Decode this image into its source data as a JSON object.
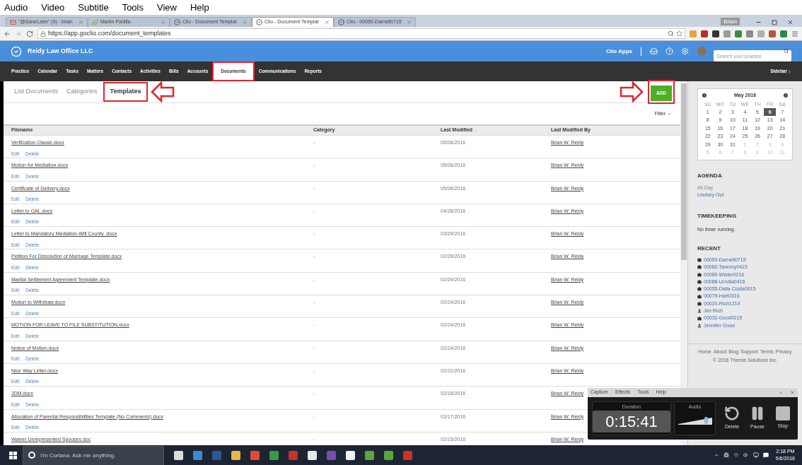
{
  "app_menu": [
    "Audio",
    "Video",
    "Subtitle",
    "Tools",
    "View",
    "Help"
  ],
  "browser": {
    "tabs": [
      {
        "kind": "mail",
        "title": "\"@SaneLater\" (9) - brian",
        "selected": false
      },
      {
        "kind": "leaf",
        "title": "Martin Padilla",
        "selected": false
      },
      {
        "kind": "check",
        "title": "Clio - Document Templat",
        "selected": false
      },
      {
        "kind": "check",
        "title": "Clio - Document Templat",
        "selected": true
      },
      {
        "kind": "check",
        "title": "Clio - 00050-Darnell0715",
        "selected": false
      }
    ],
    "profile": "Brian",
    "url": "https://app.goclio.com/document_templates",
    "extensions": [
      {
        "color": "#e8a33a"
      },
      {
        "color": "#b52d2d"
      },
      {
        "color": "#333333"
      },
      {
        "color": "#9a9a9a"
      },
      {
        "color": "#3c8c3c"
      },
      {
        "color": "#8a8a8a"
      },
      {
        "color": "#b0b0b0"
      },
      {
        "color": "#c0503a"
      },
      {
        "color": "#2c8a4a"
      }
    ]
  },
  "header": {
    "firm": "Reidy Law Office LLC",
    "apps": "Clio Apps",
    "search_placeholder": "Search your practice"
  },
  "nav": {
    "items": [
      {
        "label": "Practice",
        "selected": false
      },
      {
        "label": "Calendar",
        "selected": false
      },
      {
        "label": "Tasks",
        "selected": false
      },
      {
        "label": "Matters",
        "selected": false
      },
      {
        "label": "Contacts",
        "selected": false
      },
      {
        "label": "Activities",
        "selected": false
      },
      {
        "label": "Bills",
        "selected": false
      },
      {
        "label": "Accounts",
        "selected": false
      },
      {
        "label": "Documents",
        "selected": true
      },
      {
        "label": "Communications",
        "selected": false
      },
      {
        "label": "Reports",
        "selected": false
      }
    ],
    "sidebar": "Sidebar"
  },
  "subtabs": [
    {
      "label": "List Documents",
      "selected": false
    },
    {
      "label": "Categories",
      "selected": false
    },
    {
      "label": "Templates",
      "selected": true
    }
  ],
  "add_button": "ADD",
  "filter": "Filter",
  "table": {
    "columns": [
      {
        "label": "Filename",
        "sorted": false
      },
      {
        "label": "Category",
        "sorted": false
      },
      {
        "label": "Last Modified",
        "sorted": true
      },
      {
        "label": "Last Modified By",
        "sorted": false
      }
    ],
    "rows": [
      {
        "filename": "Verification Clause.docx",
        "category": "-",
        "modified": "05/06/2016",
        "by": "Brian W. Reidy",
        "actions": [
          "Edit",
          "Delete"
        ]
      },
      {
        "filename": "Motion for Mediation.docx",
        "category": "-",
        "modified": "05/06/2016",
        "by": "Brian W. Reidy",
        "actions": [
          "Edit",
          "Delete"
        ]
      },
      {
        "filename": "Certificate of Delivery.docx",
        "category": "-",
        "modified": "05/06/2016",
        "by": "Brian W. Reidy",
        "actions": [
          "Edit",
          "Delete"
        ]
      },
      {
        "filename": "Letter to GAL.docx",
        "category": "-",
        "modified": "04/26/2016",
        "by": "Brian W. Reidy",
        "actions": [
          "Edit",
          "Delete"
        ]
      },
      {
        "filename": "Letter to Mandatory Mediation-Will County .docx",
        "category": "-",
        "modified": "03/29/2016",
        "by": "Brian W. Reidy",
        "actions": [
          "Edit",
          "Delete"
        ]
      },
      {
        "filename": "Petition For Dissolution of Marriage Template.docx",
        "category": "-",
        "modified": "02/28/2016",
        "by": "Brian W. Reidy",
        "actions": [
          "Edit",
          "Delete"
        ]
      },
      {
        "filename": "Marital Settlement Agreement Template.docx",
        "category": "-",
        "modified": "02/24/2016",
        "by": "Brian W. Reidy",
        "actions": [
          "Edit",
          "Delete"
        ]
      },
      {
        "filename": "Motion to Withdraw.docx",
        "category": "-",
        "modified": "02/24/2016",
        "by": "Brian W. Reidy",
        "actions": [
          "Edit",
          "Delete"
        ]
      },
      {
        "filename": "MOTION FOR LEAVE TO FILE SUBSTITUTION.docx",
        "category": "-",
        "modified": "02/24/2016",
        "by": "Brian W. Reidy",
        "actions": [
          "Edit",
          "Delete"
        ]
      },
      {
        "filename": "Notice of Motion.docx",
        "category": "-",
        "modified": "02/24/2016",
        "by": "Brian W. Reidy",
        "actions": [
          "Edit",
          "Delete"
        ]
      },
      {
        "filename": "Nice Way Letter.docx",
        "category": "-",
        "modified": "02/22/2016",
        "by": "Brian W. Reidy",
        "actions": [
          "Edit",
          "Delete"
        ]
      },
      {
        "filename": "JDM.docx",
        "category": "-",
        "modified": "02/18/2016",
        "by": "Brian W. Reidy",
        "actions": [
          "Edit",
          "Delete"
        ]
      },
      {
        "filename": "Allocation of Parental Responsibilities Template (No Comments).docx",
        "category": "-",
        "modified": "02/17/2016",
        "by": "Brian W. Reidy",
        "actions": [
          "Edit",
          "Delete"
        ]
      },
      {
        "filename": "Waiver Unrepresented Spouses.doc",
        "category": "-",
        "modified": "02/15/2016",
        "by": "Brian W. Reidy"
      }
    ]
  },
  "calendar": {
    "title": "May 2016",
    "weekdays": [
      "SU",
      "MO",
      "TU",
      "WE",
      "TH",
      "FR",
      "SA"
    ],
    "days": [
      {
        "day": "1",
        "muted": false,
        "selected": false
      },
      {
        "day": "2",
        "muted": false,
        "selected": false
      },
      {
        "day": "3",
        "muted": false,
        "selected": false
      },
      {
        "day": "4",
        "muted": false,
        "selected": false
      },
      {
        "day": "5",
        "muted": false,
        "selected": false
      },
      {
        "day": "6",
        "muted": false,
        "selected": true
      },
      {
        "day": "7",
        "muted": false,
        "selected": false
      },
      {
        "day": "8",
        "muted": false,
        "selected": false
      },
      {
        "day": "9",
        "muted": false,
        "selected": false
      },
      {
        "day": "10",
        "muted": false,
        "selected": false
      },
      {
        "day": "11",
        "muted": false,
        "selected": false
      },
      {
        "day": "12",
        "muted": false,
        "selected": false
      },
      {
        "day": "13",
        "muted": false,
        "selected": false
      },
      {
        "day": "14",
        "muted": false,
        "selected": false
      },
      {
        "day": "15",
        "muted": false,
        "selected": false
      },
      {
        "day": "16",
        "muted": false,
        "selected": false
      },
      {
        "day": "17",
        "muted": false,
        "selected": false
      },
      {
        "day": "18",
        "muted": false,
        "selected": false
      },
      {
        "day": "19",
        "muted": false,
        "selected": false
      },
      {
        "day": "20",
        "muted": false,
        "selected": false
      },
      {
        "day": "21",
        "muted": false,
        "selected": false
      },
      {
        "day": "22",
        "muted": false,
        "selected": false
      },
      {
        "day": "23",
        "muted": false,
        "selected": false
      },
      {
        "day": "24",
        "muted": false,
        "selected": false
      },
      {
        "day": "25",
        "muted": false,
        "selected": false
      },
      {
        "day": "26",
        "muted": false,
        "selected": false
      },
      {
        "day": "27",
        "muted": false,
        "selected": false
      },
      {
        "day": "28",
        "muted": false,
        "selected": false
      },
      {
        "day": "29",
        "muted": false,
        "selected": false
      },
      {
        "day": "30",
        "muted": false,
        "selected": false
      },
      {
        "day": "31",
        "muted": false,
        "selected": false
      },
      {
        "day": "1",
        "muted": true,
        "selected": false
      },
      {
        "day": "2",
        "muted": true,
        "selected": false
      },
      {
        "day": "3",
        "muted": true,
        "selected": false
      },
      {
        "day": "4",
        "muted": true,
        "selected": false
      },
      {
        "day": "5",
        "muted": true,
        "selected": false
      },
      {
        "day": "6",
        "muted": true,
        "selected": false
      },
      {
        "day": "7",
        "muted": true,
        "selected": false
      },
      {
        "day": "8",
        "muted": true,
        "selected": false
      },
      {
        "day": "9",
        "muted": true,
        "selected": false
      },
      {
        "day": "10",
        "muted": true,
        "selected": false
      },
      {
        "day": "11",
        "muted": true,
        "selected": false
      }
    ]
  },
  "agenda": {
    "heading": "AGENDA",
    "label": "All Day",
    "event": "Lindsey Out"
  },
  "timekeeping": {
    "heading": "TIMEKEEPING",
    "text": "No timer running."
  },
  "recent": {
    "heading": "RECENT",
    "items": [
      {
        "kind": "matter",
        "label": "00050-Darnell0715"
      },
      {
        "kind": "matter",
        "label": "00082-Tancrey0415"
      },
      {
        "kind": "matter",
        "label": "00089-Wister0216"
      },
      {
        "kind": "matter",
        "label": "00088-Urrutia0416"
      },
      {
        "kind": "matter",
        "label": "00055-Dalla Costa0915"
      },
      {
        "kind": "matter",
        "label": "00079-Hart0316"
      },
      {
        "kind": "matter",
        "label": "00020-Rich1214"
      },
      {
        "kind": "contact",
        "label": "Jim Rich"
      },
      {
        "kind": "matter",
        "label": "00032-Good0215"
      },
      {
        "kind": "contact",
        "label": "Jennifer Good"
      }
    ]
  },
  "footer": {
    "links": [
      "Home",
      "About",
      "Blog",
      "Support",
      "Terms",
      "Privacy"
    ],
    "copyright": "© 2016 Themis Solutions Inc."
  },
  "recorder": {
    "menu": [
      "Capture",
      "Effects",
      "Tools",
      "Help"
    ],
    "duration_label": "Duration",
    "duration": "0:15:41",
    "audio": {
      "label": "Audio",
      "level": 0.85
    },
    "buttons": [
      {
        "kind": "delete",
        "label": "Delete"
      },
      {
        "kind": "pause",
        "label": "Pause"
      },
      {
        "kind": "stop",
        "label": "Stop"
      }
    ]
  },
  "taskbar": {
    "search_placeholder": "I'm Cortana. Ask me anything.",
    "apps": [
      {
        "color": "#dddddd"
      },
      {
        "color": "#3b8ad8"
      },
      {
        "color": "#2b5797"
      },
      {
        "color": "#e8b84a"
      },
      {
        "color": "#e04a3a"
      },
      {
        "color": "#3a9a4a"
      },
      {
        "color": "#c8302a"
      },
      {
        "color": "#e8e8e8"
      },
      {
        "color": "#7a4ab0"
      },
      {
        "color": "#f0f0f0"
      },
      {
        "color": "#5aa83a"
      },
      {
        "color": "#5aa83a"
      },
      {
        "color": "#d0302a"
      }
    ],
    "time": "2:18 PM",
    "date": "5/6/2016"
  }
}
